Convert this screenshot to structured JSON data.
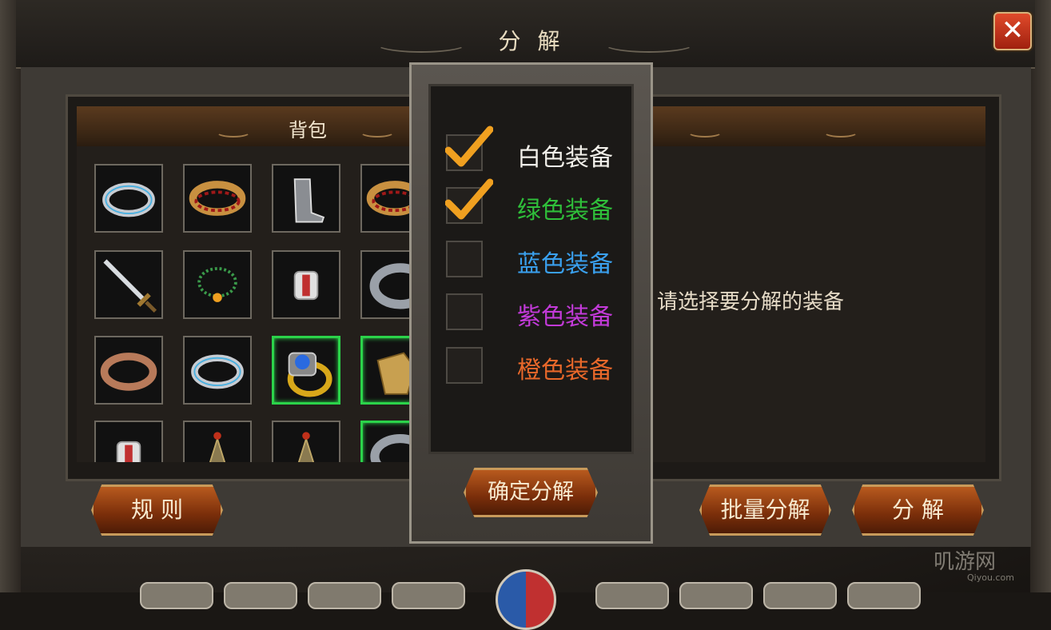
{
  "window": {
    "title": "分 解",
    "close_symbol": "✕"
  },
  "bag": {
    "title": "背包"
  },
  "hint_text": "请选择要分解的装备",
  "buttons": {
    "rules": "规 则",
    "batch": "批量分解",
    "decompose": "分 解",
    "confirm": "确定分解"
  },
  "filter_options": [
    {
      "label": "白色装备",
      "checked": true,
      "color": "#f2f0ea"
    },
    {
      "label": "绿色装备",
      "checked": true,
      "color": "#2fbf3a"
    },
    {
      "label": "蓝色装备",
      "checked": false,
      "color": "#3aa0ee"
    },
    {
      "label": "紫色装备",
      "checked": false,
      "color": "#c23ad8"
    },
    {
      "label": "橙色装备",
      "checked": false,
      "color": "#e8682a"
    }
  ],
  "inventory": [
    [
      {
        "icon": "silver-ring-icon",
        "quality": "white"
      },
      {
        "icon": "jeweled-bracelet-icon",
        "quality": "white"
      },
      {
        "icon": "iron-boots-icon",
        "quality": "white"
      },
      {
        "icon": "jeweled-bracelet-icon",
        "quality": "white"
      }
    ],
    [
      {
        "icon": "dagger-icon",
        "quality": "white"
      },
      {
        "icon": "bead-necklace-icon",
        "quality": "white"
      },
      {
        "icon": "white-bracer-icon",
        "quality": "white"
      },
      {
        "icon": "steel-bracer-icon",
        "quality": "white"
      }
    ],
    [
      {
        "icon": "bronze-ring-icon",
        "quality": "white"
      },
      {
        "icon": "silver-ring-icon",
        "quality": "white"
      },
      {
        "icon": "sapphire-ring-icon",
        "quality": "green"
      },
      {
        "icon": "gauntlet-icon",
        "quality": "green"
      }
    ],
    [
      {
        "icon": "white-bracer-icon",
        "quality": "white"
      },
      {
        "icon": "bell-icon",
        "quality": "white"
      },
      {
        "icon": "bell-icon",
        "quality": "white"
      },
      {
        "icon": "steel-bracer-icon",
        "quality": "green"
      }
    ]
  ],
  "colors": {
    "accent": "#c89a5a",
    "green_quality": "#2bd34a",
    "check": "#f0a020"
  },
  "watermark": {
    "main": "叽游网",
    "sub": "Qiyou.com"
  }
}
